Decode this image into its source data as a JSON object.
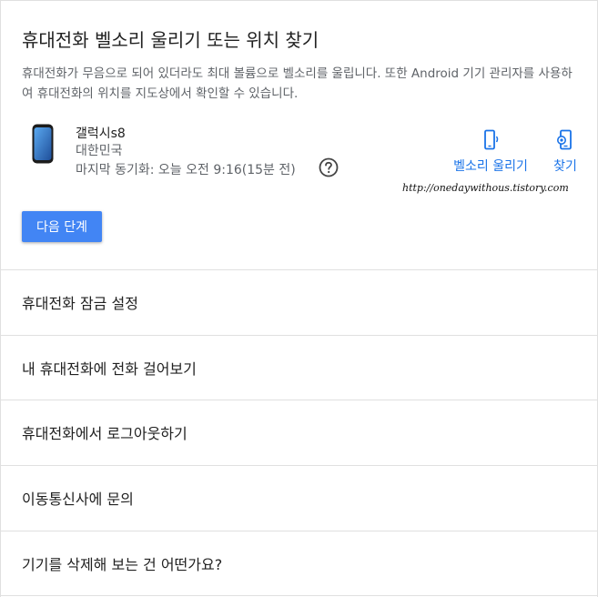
{
  "main": {
    "title": "휴대전화 벨소리 울리기 또는 위치 찾기",
    "description": "휴대전화가 무음으로 되어 있더라도 최대 볼륨으로 벨소리를 울립니다. 또한 Android 기기 관리자를 사용하여 휴대전화의 위치를 지도상에서 확인할 수 있습니다.",
    "device": {
      "name": "갤럭시s8",
      "country": "대한민국",
      "last_sync": "마지막 동기화: 오늘 오전 9:16(15분 전)"
    },
    "actions": {
      "ring_label": "벨소리 울리기",
      "find_label": "찾기"
    },
    "watermark": "http://onedaywithous.tistory.com",
    "next_button": "다음 단계",
    "accent_color": "#4285f4",
    "link_color": "#1a73e8"
  },
  "options": [
    {
      "label": "휴대전화 잠금 설정"
    },
    {
      "label": "내 휴대전화에 전화 걸어보기"
    },
    {
      "label": "휴대전화에서 로그아웃하기"
    },
    {
      "label": "이동통신사에 문의"
    },
    {
      "label": "기기를 삭제해 보는 건 어떤가요?"
    }
  ]
}
